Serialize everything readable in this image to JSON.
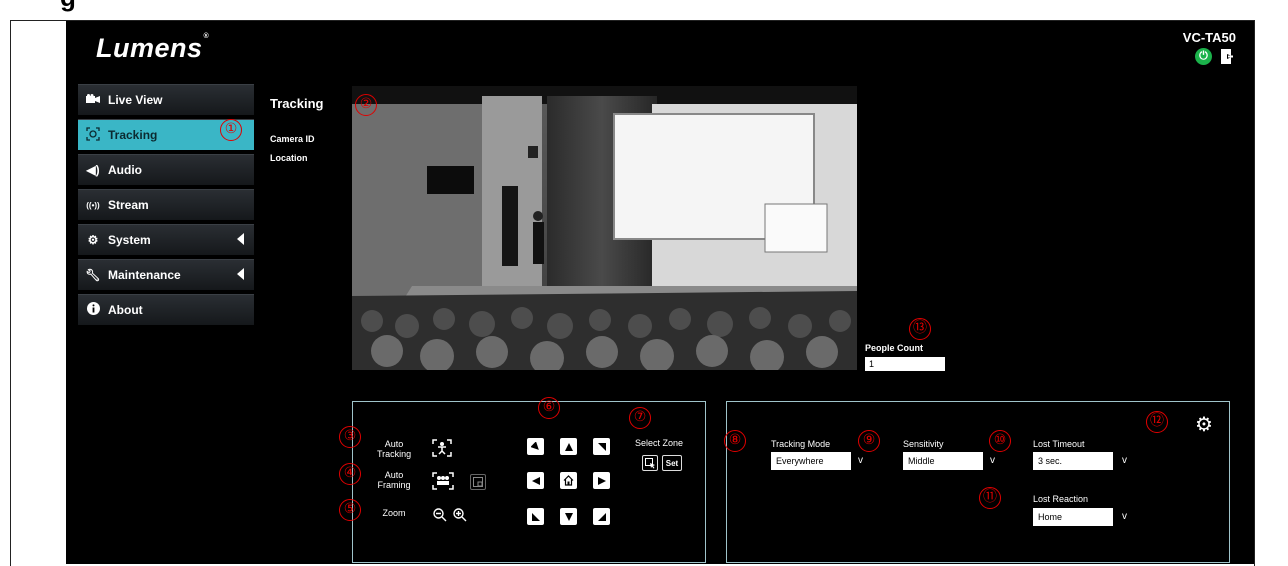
{
  "document": {
    "heading": "g"
  },
  "brand": {
    "logo": "Lumens",
    "mark": "®",
    "model": "VC-TA50"
  },
  "sidebar": {
    "items": [
      {
        "label": "Live View",
        "icon": "video-camera-icon",
        "active": false,
        "submenu": false
      },
      {
        "label": "Tracking",
        "icon": "tracking-icon",
        "active": true,
        "submenu": false
      },
      {
        "label": "Audio",
        "icon": "speaker-icon",
        "active": false,
        "submenu": false
      },
      {
        "label": "Stream",
        "icon": "broadcast-icon",
        "active": false,
        "submenu": false
      },
      {
        "label": "System",
        "icon": "gear-icon",
        "active": false,
        "submenu": true
      },
      {
        "label": "Maintenance",
        "icon": "wrench-icon",
        "active": false,
        "submenu": true
      },
      {
        "label": "About",
        "icon": "info-icon",
        "active": false,
        "submenu": false
      }
    ]
  },
  "page": {
    "title": "Tracking",
    "camera_id_label": "Camera ID",
    "location_label": "Location"
  },
  "people_count": {
    "label": "People Count",
    "value": "1"
  },
  "control_panel": {
    "auto_tracking_label": "Auto\nTracking",
    "auto_framing_label": "Auto\nFraming",
    "zoom_label": "Zoom",
    "select_zone_label": "Select Zone",
    "set_label": "Set"
  },
  "settings_panel": {
    "tracking_mode": {
      "label": "Tracking Mode",
      "value": "Everywhere"
    },
    "sensitivity": {
      "label": "Sensitivity",
      "value": "Middle"
    },
    "lost_timeout": {
      "label": "Lost Timeout",
      "value": "3 sec."
    },
    "lost_reaction": {
      "label": "Lost Reaction",
      "value": "Home"
    }
  },
  "callouts": [
    "①",
    "②",
    "③",
    "④",
    "⑤",
    "⑥",
    "⑦",
    "⑧",
    "⑨",
    "⑩",
    "⑪",
    "⑫",
    "⑬"
  ],
  "colors": {
    "accent": "#3ab6c6",
    "power": "#1bb24b",
    "callout": "#e00000",
    "panel_border": "#9fc4ca"
  }
}
